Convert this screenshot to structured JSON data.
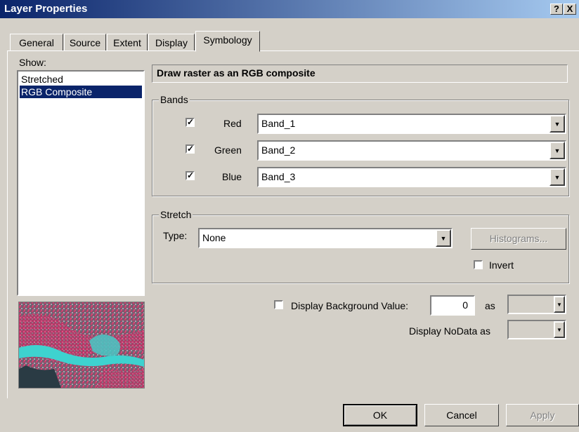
{
  "window": {
    "title": "Layer Properties",
    "help_label": "?",
    "close_label": "X"
  },
  "tabs": [
    {
      "label": "General",
      "active": false
    },
    {
      "label": "Source",
      "active": false
    },
    {
      "label": "Extent",
      "active": false
    },
    {
      "label": "Display",
      "active": false
    },
    {
      "label": "Symbology",
      "active": true
    }
  ],
  "show": {
    "label": "Show:",
    "items": [
      {
        "label": "Stretched",
        "selected": false
      },
      {
        "label": "RGB Composite",
        "selected": true
      }
    ]
  },
  "heading": "Draw raster as an RGB composite",
  "bands": {
    "legend": "Bands",
    "rows": [
      {
        "checked": true,
        "label": "Red",
        "value": "Band_1"
      },
      {
        "checked": true,
        "label": "Green",
        "value": "Band_2"
      },
      {
        "checked": true,
        "label": "Blue",
        "value": "Band_3"
      }
    ]
  },
  "stretch": {
    "legend": "Stretch",
    "type_label": "Type:",
    "type_value": "None",
    "histograms_label": "Histograms...",
    "invert_label": "Invert",
    "invert_checked": false
  },
  "background": {
    "label": "Display Background Value:",
    "checked": false,
    "value": "0",
    "as_label": "as"
  },
  "nodata": {
    "label": "Display NoData as"
  },
  "footer": {
    "ok_label": "OK",
    "cancel_label": "Cancel",
    "apply_label": "Apply"
  },
  "colors": {
    "title_start": "#0a246a",
    "title_end": "#a6caf0",
    "selection": "#0a246a",
    "face": "#d4d0c8"
  }
}
